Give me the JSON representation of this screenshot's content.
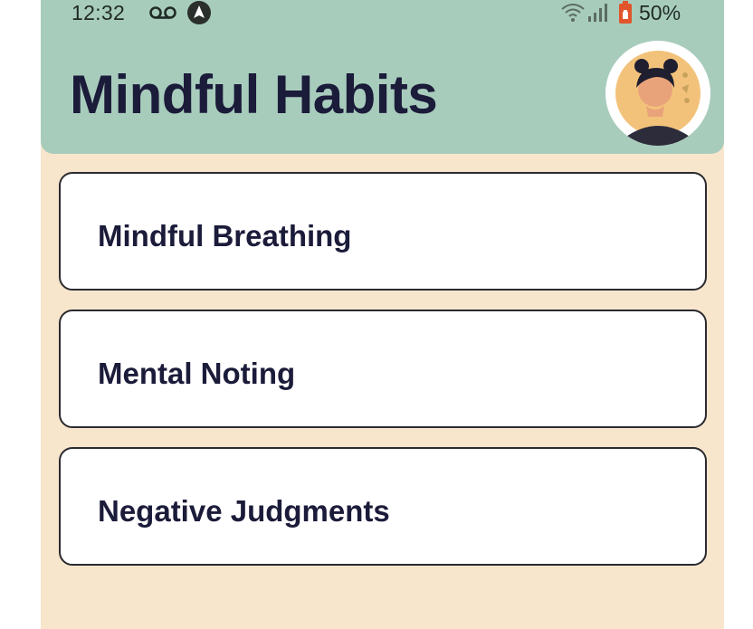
{
  "status_bar": {
    "time": "12:32",
    "battery": "50%",
    "icons": [
      "voicemail-icon",
      "navigation-icon",
      "wifi-icon",
      "signal-icon",
      "battery-icon"
    ]
  },
  "header": {
    "title": "Mindful Habits",
    "avatar": "user-avatar"
  },
  "habits": [
    {
      "label": "Mindful Breathing"
    },
    {
      "label": "Mental Noting"
    },
    {
      "label": "Negative Judgments"
    }
  ],
  "colors": {
    "header_bg": "#a8ccbc",
    "page_bg": "#f8e6cc",
    "card_bg": "#ffffff",
    "text_dark": "#1b1b3a",
    "battery_accent": "#e2542b"
  }
}
